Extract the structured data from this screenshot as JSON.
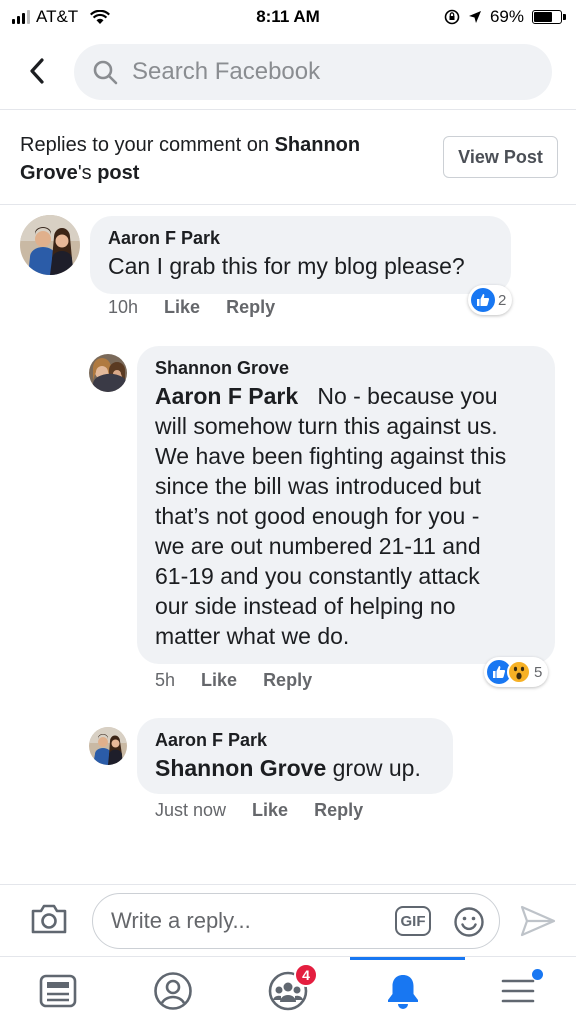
{
  "status_bar": {
    "carrier": "AT&T",
    "time": "8:11 AM",
    "battery": "69%",
    "battery_level": 0.69
  },
  "search": {
    "placeholder": "Search Facebook"
  },
  "context": {
    "prefix": "Replies to your comment on ",
    "person": "Shannon Grove",
    "suffix": "'s ",
    "post_word": "post",
    "view_post_label": "View Post"
  },
  "comments": [
    {
      "author": "Aaron F Park",
      "text": "Can I grab this for my blog please?",
      "time": "10h",
      "like_label": "Like",
      "reply_label": "Reply",
      "reaction_count": "2"
    },
    {
      "author": "Shannon Grove",
      "mention": "Aaron F Park",
      "text_lines": [
        "No - because you",
        "will somehow turn this against us.",
        "We have been fighting against this",
        "since the bill was introduced but",
        "that’s not good enough for you -",
        "we are out numbered 21-11 and",
        "61-19 and you constantly attack",
        "our side instead of helping no",
        "matter what we do."
      ],
      "time": "5h",
      "like_label": "Like",
      "reply_label": "Reply",
      "reaction_count": "5"
    },
    {
      "author": "Aaron F Park",
      "mention": "Shannon Grove",
      "text": " grow up.",
      "time": "Just now",
      "like_label": "Like",
      "reply_label": "Reply"
    }
  ],
  "composer": {
    "placeholder": "Write a reply...",
    "gif_label": "GIF"
  },
  "tabbar": {
    "groups_badge": "4"
  },
  "colors": {
    "accent": "#1877f2",
    "badge": "#e41e3f",
    "bubble": "#f0f2f5"
  }
}
